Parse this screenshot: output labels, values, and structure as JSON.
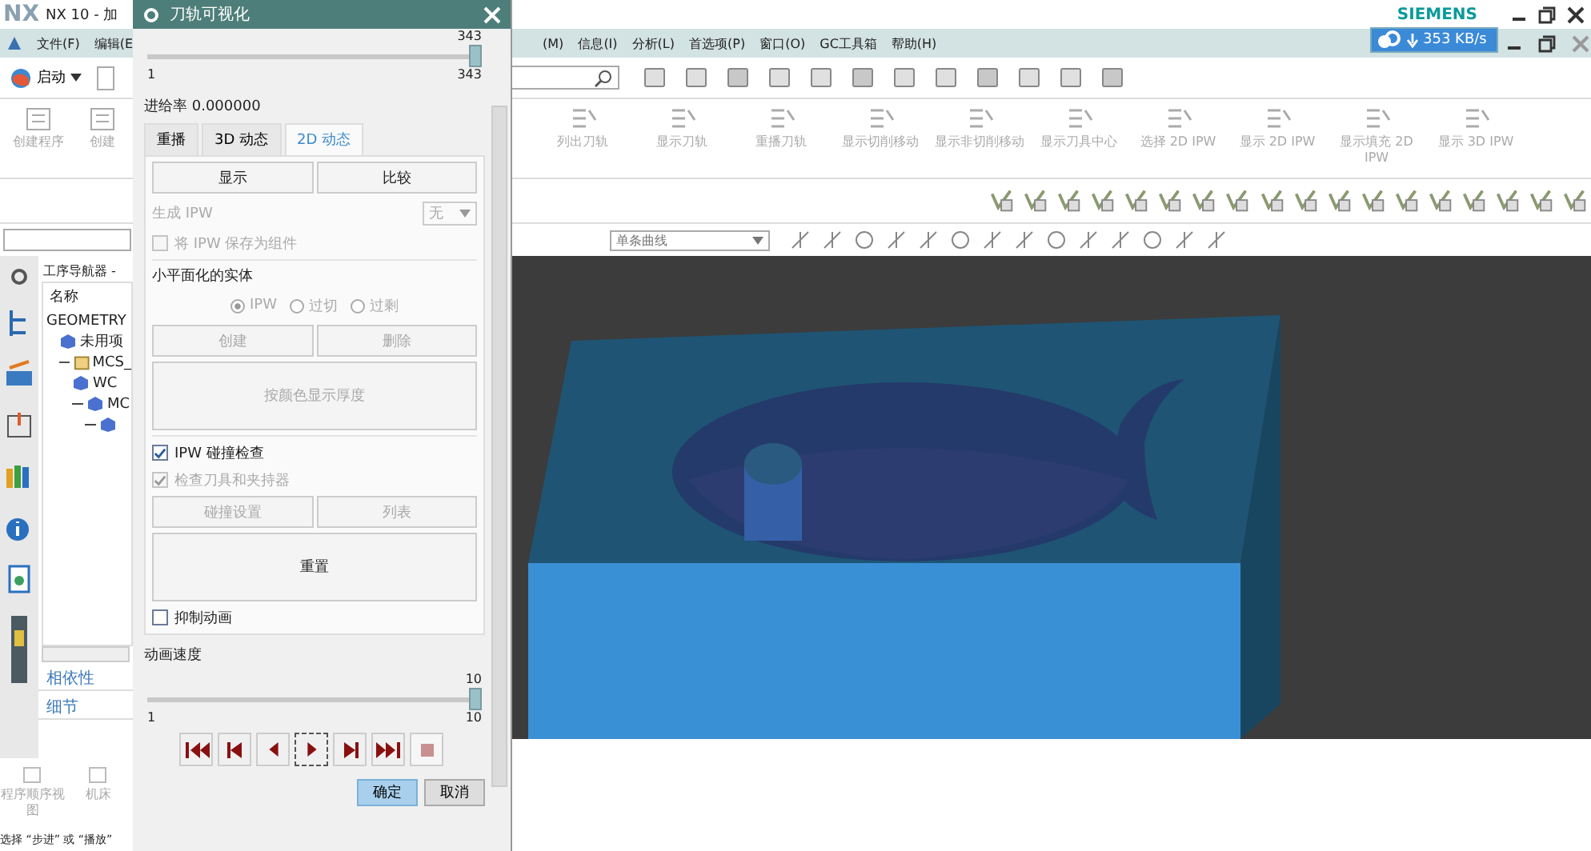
{
  "app": {
    "logo": "NX",
    "title": "NX 10 - 加",
    "brand": "SIEMENS",
    "network_speed": "353 KB/s"
  },
  "menu_left": [
    "文件(F)",
    "编辑(E"
  ],
  "menu_right": [
    "(M)",
    "信息(I)",
    "分析(L)",
    "首选项(P)",
    "窗口(O)",
    "GC工具箱",
    "帮助(H)"
  ],
  "start_button": "启动",
  "ribbon_left": [
    {
      "label": "创建程序",
      "disabled": true
    },
    {
      "label": "创建",
      "disabled": true
    }
  ],
  "ribbon_right": [
    {
      "label": "列出刀轨",
      "disabled": true
    },
    {
      "label": "显示刀轨",
      "disabled": true
    },
    {
      "label": "重播刀轨",
      "disabled": true
    },
    {
      "label": "显示切削移动",
      "disabled": true
    },
    {
      "label": "显示非切削移动",
      "disabled": true
    },
    {
      "label": "显示刀具中心",
      "disabled": true
    },
    {
      "label": "选择 2D IPW",
      "disabled": true
    },
    {
      "label": "显示 2D IPW",
      "disabled": true
    },
    {
      "label": "显示填充 2D IPW",
      "disabled": true
    },
    {
      "label": "显示 3D IPW",
      "disabled": true
    }
  ],
  "curve_filter": "单条曲线",
  "navigator": {
    "title": "工序导航器 -",
    "column": "名称",
    "tree": [
      {
        "label": "GEOMETRY",
        "children": [
          {
            "label": "未用项"
          },
          {
            "label": "MCS_",
            "expanded": true,
            "children": [
              {
                "label": "WC"
              },
              {
                "label": "MC",
                "expanded": true
              }
            ]
          }
        ]
      }
    ]
  },
  "panels": [
    "相依性",
    "细节"
  ],
  "bottom_views": [
    "程序顺序视图",
    "机床"
  ],
  "status": "选择 “步进” 或 “播放”",
  "dialog": {
    "title": "刀轨可视化",
    "replay_slider": {
      "top_label": "343",
      "min_label": "1",
      "max_label": "343",
      "level": 1
    },
    "feed_rate": "进给率 0.000000",
    "tabs": [
      {
        "label": "重播",
        "selected": false
      },
      {
        "label": "3D 动态",
        "selected": false
      },
      {
        "label": "2D 动态",
        "selected": true
      }
    ],
    "top_buttons": [
      "显示",
      "比较"
    ],
    "generate_ipw": {
      "label": "生成 IPW",
      "value": "无",
      "disabled": true
    },
    "save_ipw": {
      "label": "将 IPW 保存为组件",
      "checked": false,
      "disabled": true
    },
    "facet_section": "小平面化的实体",
    "facet_options": [
      {
        "label": "IPW",
        "selected": true
      },
      {
        "label": "过切",
        "selected": false
      },
      {
        "label": "过剩",
        "selected": false
      }
    ],
    "facet_buttons": [
      {
        "label": "创建",
        "disabled": true
      },
      {
        "label": "删除",
        "disabled": true
      }
    ],
    "thickness_button": {
      "label": "按颜色显示厚度",
      "disabled": true
    },
    "collision_check": {
      "label": "IPW 碰撞检查",
      "checked": true,
      "disabled": false
    },
    "check_holder": {
      "label": "检查刀具和夹持器",
      "checked": true,
      "disabled": true
    },
    "collision_buttons": [
      {
        "label": "碰撞设置",
        "disabled": true
      },
      {
        "label": "列表",
        "disabled": true
      }
    ],
    "reset_button": "重置",
    "suppress_animation": {
      "label": "抑制动画",
      "checked": false,
      "disabled": false
    },
    "speed_label": "动画速度",
    "speed_slider": {
      "top_label": "10",
      "min_label": "1",
      "max_label": "10",
      "level": 1
    },
    "playback": [
      {
        "kind": "first",
        "selected": false,
        "disabled": false
      },
      {
        "kind": "step-back",
        "selected": false,
        "disabled": false
      },
      {
        "kind": "reverse",
        "selected": false,
        "disabled": false
      },
      {
        "kind": "play",
        "selected": true,
        "disabled": false
      },
      {
        "kind": "step",
        "selected": false,
        "disabled": false
      },
      {
        "kind": "last",
        "selected": false,
        "disabled": false
      },
      {
        "kind": "stop",
        "selected": false,
        "disabled": true
      }
    ],
    "ok_button": "确定",
    "cancel_button": "取消"
  }
}
